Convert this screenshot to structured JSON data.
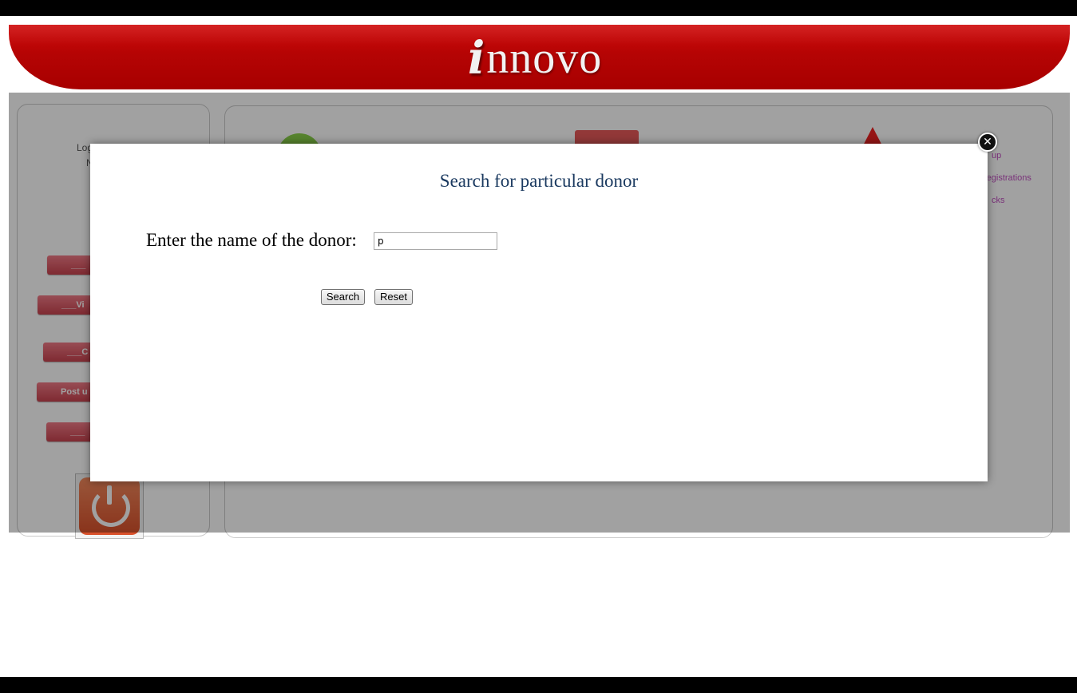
{
  "header": {
    "logo_initial": "i",
    "logo_rest": "nnovo"
  },
  "background": {
    "login_line1": "Log",
    "login_line2": "N",
    "side_buttons": [
      "___",
      "___Vi",
      "___C",
      "Post u",
      "___"
    ],
    "side_links": [
      "up",
      "registrations",
      "cks"
    ]
  },
  "modal": {
    "title": "Search for particular donor",
    "donor_label": "Enter the name of the donor:",
    "donor_value": "p",
    "search_label": "Search",
    "reset_label": "Reset",
    "close_icon": "close-icon"
  },
  "colors": {
    "header_red": "#b50404",
    "title_blue": "#1b3a60",
    "overlay": "rgba(0,0,0,0.37)"
  }
}
